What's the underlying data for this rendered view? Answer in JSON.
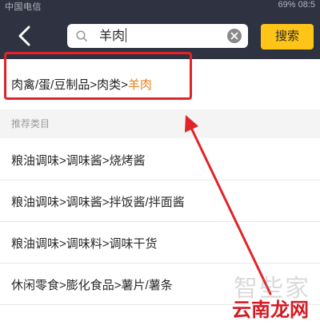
{
  "status_bar": {
    "carrier": "中国电信",
    "right": "69% 08:5"
  },
  "header": {
    "search_value": "羊肉",
    "search_button_label": "搜索"
  },
  "suggestion": {
    "path_prefix": "肉禽/蛋/豆制品>肉类>",
    "highlighted_term": "羊肉"
  },
  "recommended": {
    "title": "推荐类目",
    "items": [
      "粮油调味>调味酱>烧烤酱",
      "粮油调味>调味酱>拌饭酱/拌面酱",
      "粮油调味>调味料>调味干货",
      "休闲零食>膨化食品>薯片/薯条"
    ]
  },
  "watermarks": {
    "zhixiejia": "智些家",
    "yunnanlongwang": "云南龙网"
  },
  "colors": {
    "header_bg": "#2f3240",
    "search_button": "#ffc418",
    "highlight_term": "#e8821e",
    "annotation_red": "#e0242a"
  }
}
